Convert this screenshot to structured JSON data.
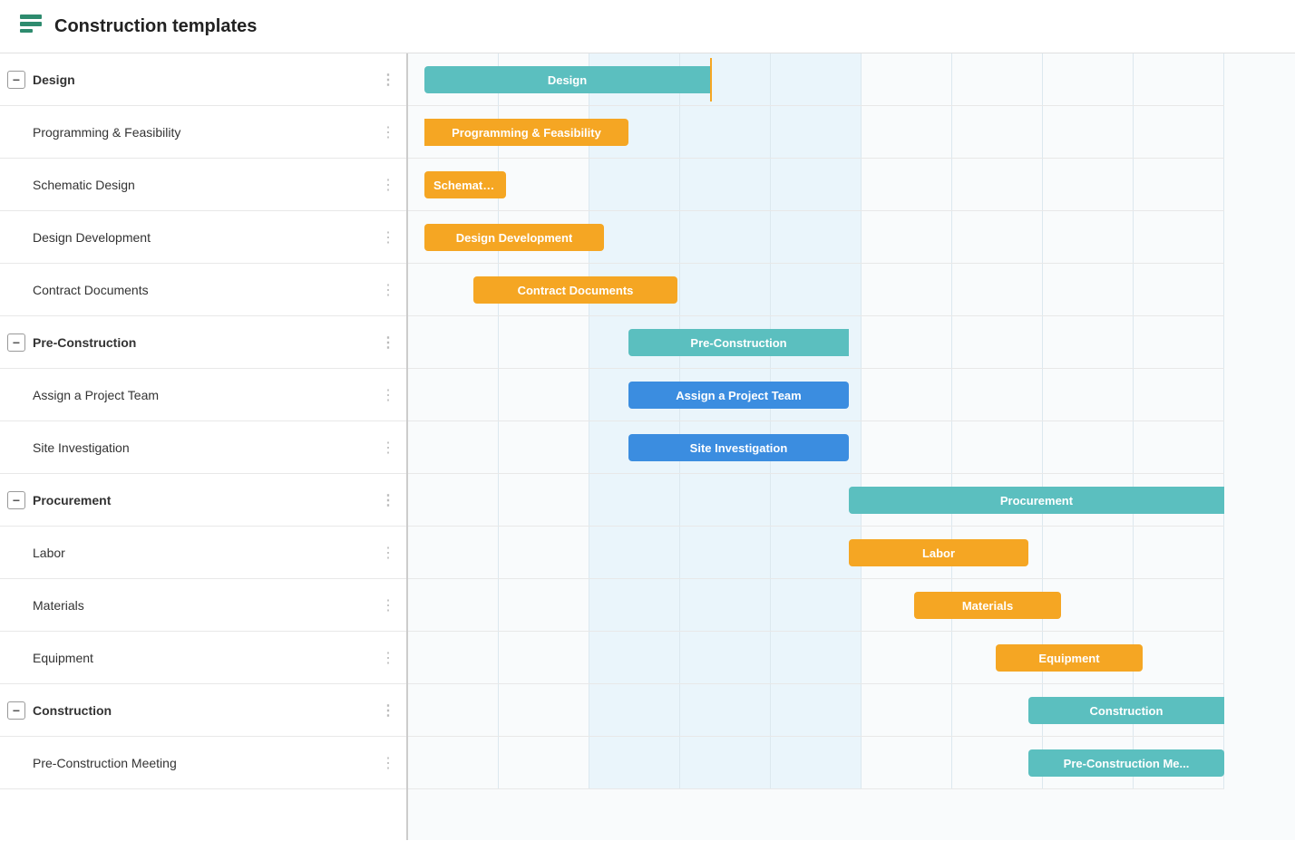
{
  "header": {
    "title": "Construction templates",
    "icon": "templates-icon"
  },
  "groups": [
    {
      "id": "design",
      "label": "Design",
      "collapsed": false,
      "children": [
        {
          "id": "prog-feas",
          "label": "Programming & Feasibility"
        },
        {
          "id": "schematic",
          "label": "Schematic Design"
        },
        {
          "id": "design-dev",
          "label": "Design Development"
        },
        {
          "id": "contract-docs",
          "label": "Contract Documents"
        }
      ]
    },
    {
      "id": "pre-construction",
      "label": "Pre-Construction",
      "collapsed": false,
      "children": [
        {
          "id": "assign-team",
          "label": "Assign a Project Team"
        },
        {
          "id": "site-inv",
          "label": "Site Investigation"
        }
      ]
    },
    {
      "id": "procurement",
      "label": "Procurement",
      "collapsed": false,
      "children": [
        {
          "id": "labor",
          "label": "Labor"
        },
        {
          "id": "materials",
          "label": "Materials"
        },
        {
          "id": "equipment",
          "label": "Equipment"
        }
      ]
    },
    {
      "id": "construction",
      "label": "Construction",
      "collapsed": false,
      "children": [
        {
          "id": "pre-con-meeting",
          "label": "Pre-Construction Meeting"
        }
      ]
    }
  ],
  "gantt": {
    "cols": 9,
    "highlightCols": [
      2,
      3,
      4
    ],
    "bars": {
      "design": {
        "label": "Design",
        "color": "teal",
        "left": "2%",
        "width": "35%"
      },
      "prog-feas": {
        "label": "Programming & Feasibility",
        "color": "orange",
        "left": "2%",
        "width": "25%"
      },
      "schematic": {
        "label": "Schematic Design",
        "color": "orange",
        "left": "2%",
        "width": "10%"
      },
      "design-dev": {
        "label": "Design Development",
        "color": "orange",
        "left": "2%",
        "width": "22%"
      },
      "contract-docs": {
        "label": "Contract Documents",
        "color": "orange",
        "left": "8%",
        "width": "25%"
      },
      "pre-construction": {
        "label": "Pre-Construction",
        "color": "teal",
        "left": "27%",
        "width": "27%"
      },
      "assign-team": {
        "label": "Assign a Project Team",
        "color": "blue",
        "left": "27%",
        "width": "27%"
      },
      "site-inv": {
        "label": "Site Investigation",
        "color": "blue",
        "left": "27%",
        "width": "27%"
      },
      "procurement": {
        "label": "Procurement",
        "color": "cyan",
        "left": "54%",
        "width": "46%"
      },
      "labor": {
        "label": "Labor",
        "color": "orange",
        "left": "54%",
        "width": "22%"
      },
      "materials": {
        "label": "Materials",
        "color": "orange",
        "left": "62%",
        "width": "18%"
      },
      "equipment": {
        "label": "Equipment",
        "color": "orange",
        "left": "72%",
        "width": "18%"
      },
      "construction": {
        "label": "Construction",
        "color": "teal",
        "left": "76%",
        "width": "24%"
      },
      "pre-con-meeting": {
        "label": "Pre-Construction Me...",
        "color": "cyan",
        "left": "76%",
        "width": "24%"
      }
    }
  },
  "collapse_symbol": "−",
  "drag_handle_symbol": "⋮"
}
